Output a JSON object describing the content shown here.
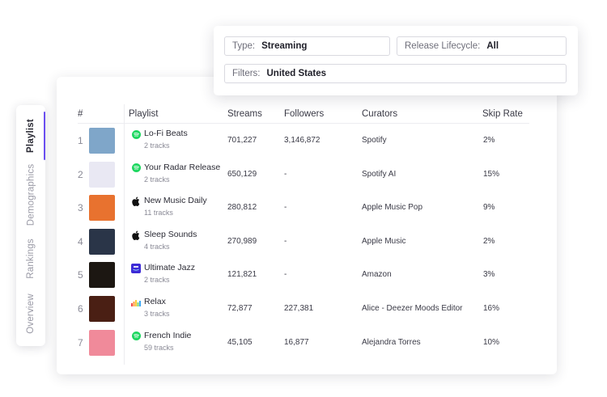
{
  "side_tabs": [
    "Playlist",
    "Demographics",
    "Rankings",
    "Overview"
  ],
  "filters": {
    "type_label": "Type:",
    "type_value": "Streaming",
    "lifecycle_label": "Release Lifecycle:",
    "lifecycle_value": "All",
    "filters_label": "Filters:",
    "filters_value": "United States"
  },
  "table": {
    "headers": {
      "rank": "#",
      "playlist": "Playlist",
      "streams": "Streams",
      "followers": "Followers",
      "curators": "Curators",
      "skip_rate": "Skip Rate"
    },
    "rows": [
      {
        "rank": "1",
        "name": "Lo-Fi Beats",
        "tracks": "2 tracks",
        "streams": "701,227",
        "followers": "3,146,872",
        "curator": "Spotify",
        "skip_rate": "2%",
        "platform_icon": "spotify-icon",
        "cover_color": "#7fa6c9"
      },
      {
        "rank": "2",
        "name": "Your Radar Release",
        "tracks": "2 tracks",
        "streams": "650,129",
        "followers": "-",
        "curator": "Spotify AI",
        "skip_rate": "15%",
        "platform_icon": "spotify-icon",
        "cover_color": "#e9e8f3"
      },
      {
        "rank": "3",
        "name": "New Music Daily",
        "tracks": "11 tracks",
        "streams": "280,812",
        "followers": "-",
        "curator": "Apple Music Pop",
        "skip_rate": "9%",
        "platform_icon": "apple-icon",
        "cover_color": "#e8722f"
      },
      {
        "rank": "4",
        "name": "Sleep Sounds",
        "tracks": "4 tracks",
        "streams": "270,989",
        "followers": "-",
        "curator": "Apple Music",
        "skip_rate": "2%",
        "platform_icon": "apple-icon",
        "cover_color": "#2a3548"
      },
      {
        "rank": "5",
        "name": "Ultimate Jazz",
        "tracks": "2 tracks",
        "streams": "121,821",
        "followers": "-",
        "curator": "Amazon",
        "skip_rate": "3%",
        "platform_icon": "amazon-music-icon",
        "cover_color": "#1c1712"
      },
      {
        "rank": "6",
        "name": "Relax",
        "tracks": "3 tracks",
        "streams": "72,877",
        "followers": "227,381",
        "curator": "Alice - Deezer Moods Editor",
        "skip_rate": "16%",
        "platform_icon": "deezer-icon",
        "cover_color": "#4a1f14"
      },
      {
        "rank": "7",
        "name": "French Indie",
        "tracks": "59 tracks",
        "streams": "45,105",
        "followers": "16,877",
        "curator": "Alejandra Torres",
        "skip_rate": "10%",
        "platform_icon": "spotify-icon",
        "cover_color": "#f08a9a"
      }
    ]
  },
  "colors": {
    "accent": "#6b4ef0",
    "spotify": "#1ed760",
    "amazon": "#3d2bd6"
  }
}
